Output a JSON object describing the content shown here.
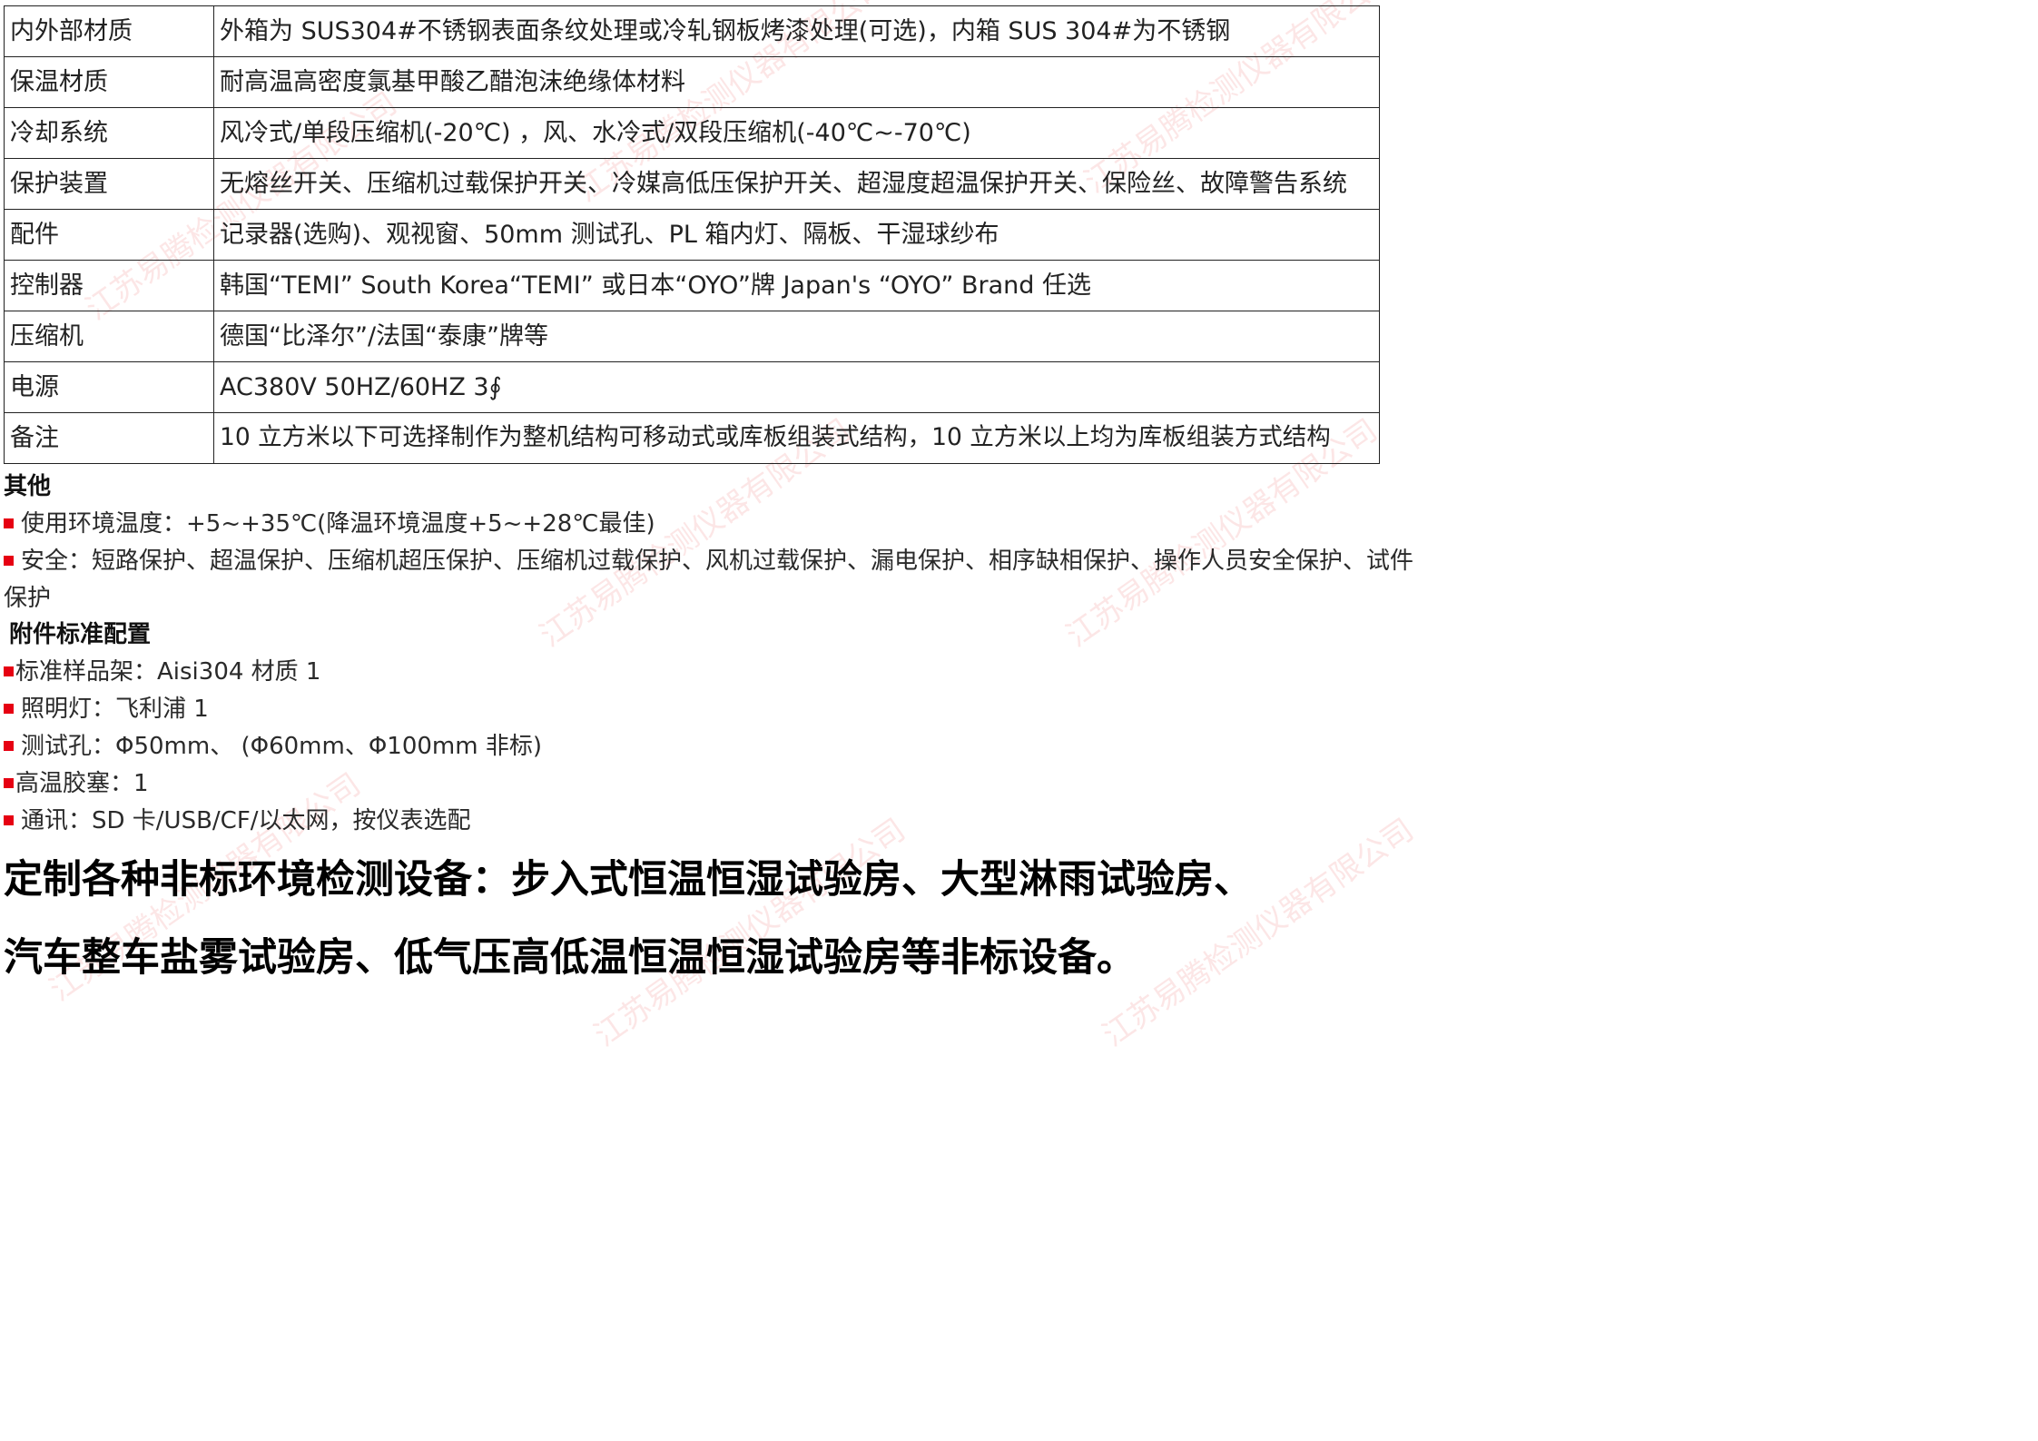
{
  "spec_table": [
    {
      "label": "内外部材质",
      "value": "外箱为 SUS304#不锈钢表面条纹处理或冷轧钢板烤漆处理(可选)，内箱 SUS 304#为不锈钢"
    },
    {
      "label": "保温材质",
      "value": "耐高温高密度氯基甲酸乙醋泡沫绝缘体材料"
    },
    {
      "label": "冷却系统",
      "value": "风冷式/单段压缩机(-20℃) ，风、水冷式/双段压缩机(-40℃~-70℃)"
    },
    {
      "label": "保护装置",
      "value": "无熔丝开关、压缩机过载保护开关、冷媒高低压保护开关、超湿度超温保护开关、保险丝、故障警告系统"
    },
    {
      "label": "配件",
      "value": "记录器(选购)、观视窗、50mm 测试孔、PL 箱内灯、隔板、干湿球纱布"
    },
    {
      "label": "控制器",
      "value": "韩国“TEMI”  South Korea“TEMI”  或日本“OYO”牌 Japan's  “OYO”  Brand   任选"
    },
    {
      "label": "压缩机",
      "value": "德国“比泽尔”/法国“泰康”牌等"
    },
    {
      "label": "电源",
      "value": "AC380V 50HZ/60HZ 3∮"
    },
    {
      "label": "备注",
      "value": "10 立方米以下可选择制作为整机结构可移动式或库板组装式结构，10 立方米以上均为库板组装方式结构"
    }
  ],
  "other": {
    "heading": "其他",
    "items": [
      "使用环境温度：+5~+35℃(降温环境温度+5~+28℃最佳)",
      "安全：短路保护、超温保护、压缩机超压保护、压缩机过载保护、风机过载保护、漏电保护、相序缺相保护、操作人员安全保护、试件保护"
    ]
  },
  "accessories": {
    "heading": "附件标准配置",
    "items": [
      "标准样品架：Aisi304 材质 1",
      "照明灯：飞利浦 1",
      "测试孔：Φ50mm、 (Φ60mm、Φ100mm 非标)",
      "高温胶塞：1",
      "通讯：SD 卡/USB/CF/以太网，按仪表选配"
    ]
  },
  "banner": {
    "line1": "定制各种非标环境检测设备：步入式恒温恒湿试验房、大型淋雨试验房、",
    "line2": "汽车整车盐雾试验房、低气压高低温恒温恒湿试验房等非标设备。"
  },
  "watermark": "江苏易腾检测仪器有限公司",
  "colors": {
    "bullet": "#e60012",
    "watermark": "#e63c3c",
    "border": "#222222"
  }
}
